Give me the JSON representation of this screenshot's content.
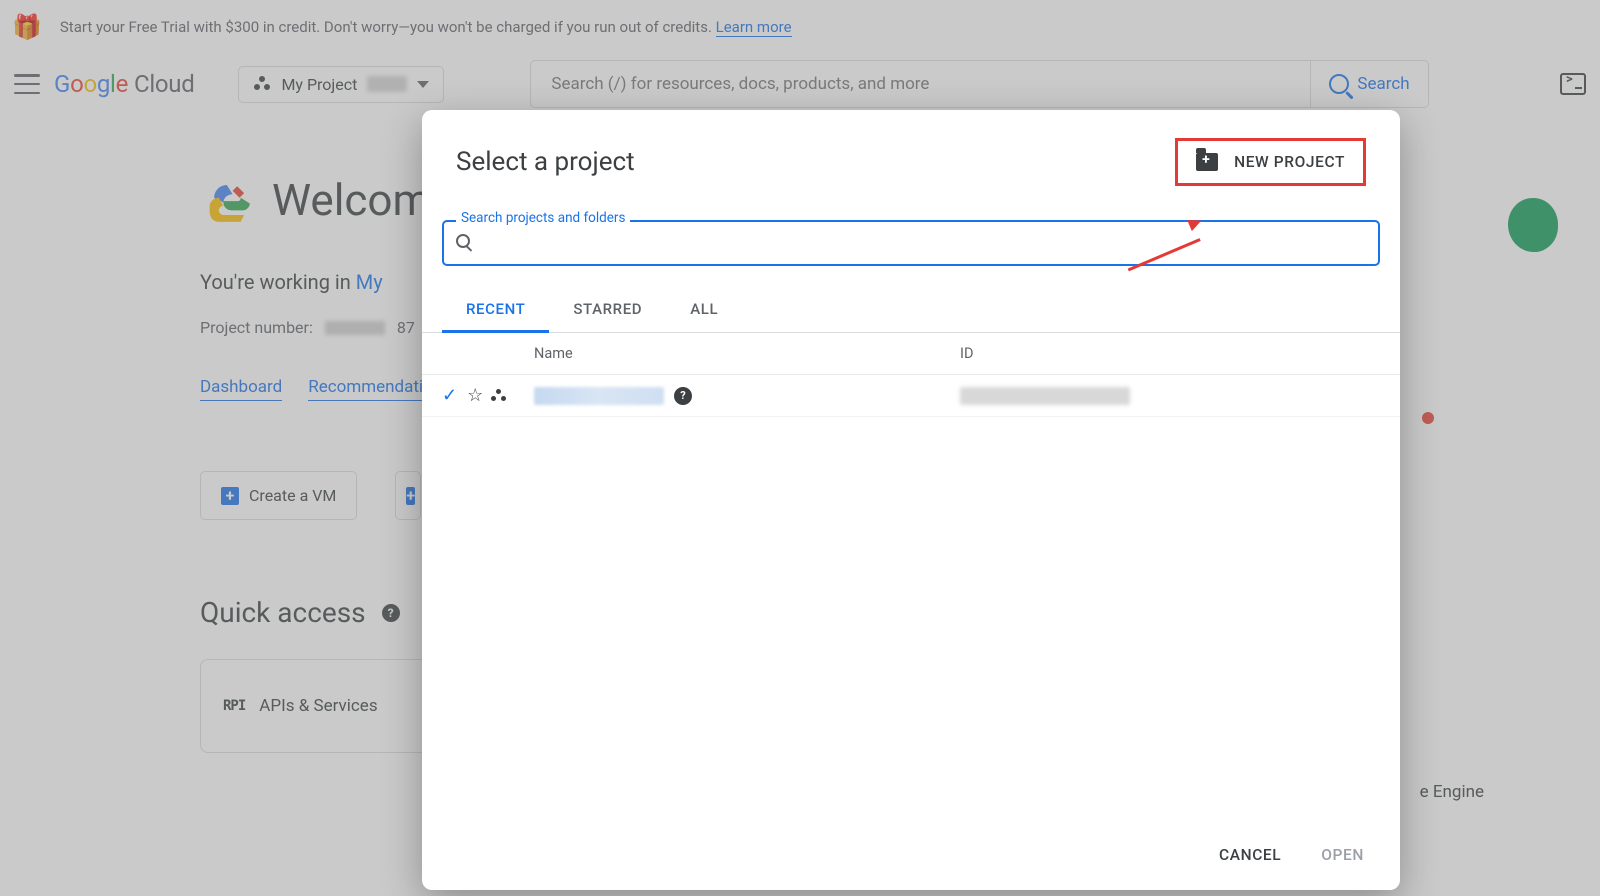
{
  "banner": {
    "text": "Start your Free Trial with $300 in credit. Don't worry—you won't be charged if you run out of credits. ",
    "link": "Learn more"
  },
  "topbar": {
    "logo_cloud": "Cloud",
    "project_label": "My Project",
    "search_placeholder": "Search (/) for resources, docs, products, and more",
    "search_button": "Search"
  },
  "main": {
    "welcome": "Welcome",
    "working_in_prefix": "You're working in ",
    "working_in_link": "My",
    "project_number_label": "Project number:",
    "project_number_suffix": "87",
    "dashboard": "Dashboard",
    "recommendations": "Recommendations",
    "create_vm": "Create a VM",
    "quick_access": "Quick access",
    "apis": "APIs & Services",
    "engine": "e Engine"
  },
  "modal": {
    "title": "Select a project",
    "new_project": "NEW PROJECT",
    "search_label": "Search projects and folders",
    "tabs": {
      "recent": "RECENT",
      "starred": "STARRED",
      "all": "ALL"
    },
    "cols": {
      "name": "Name",
      "id": "ID"
    },
    "footer": {
      "cancel": "CANCEL",
      "open": "OPEN"
    }
  }
}
